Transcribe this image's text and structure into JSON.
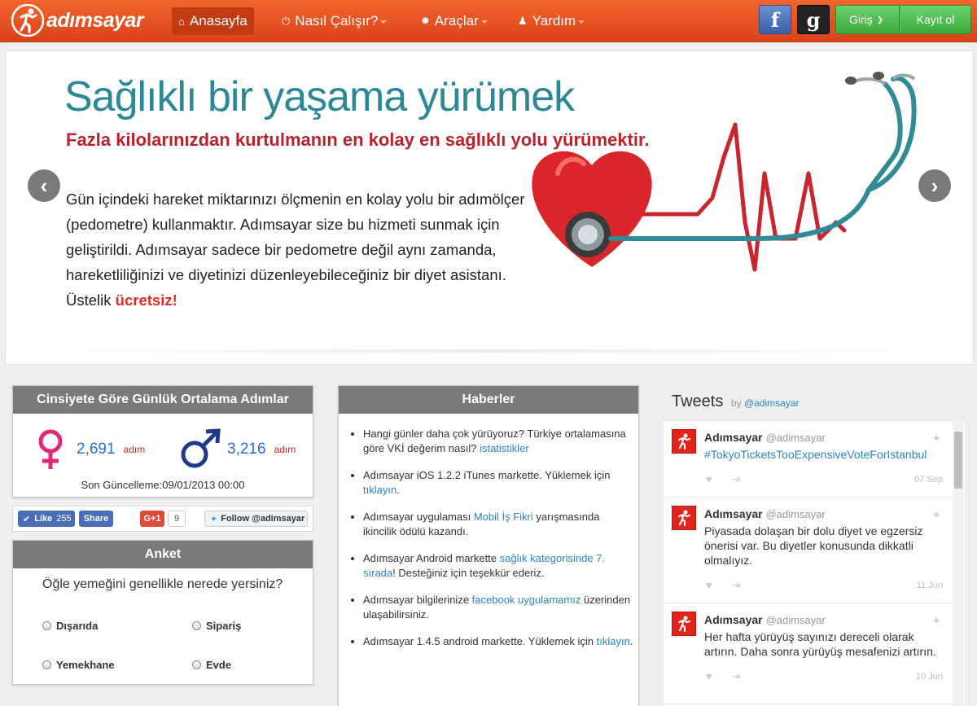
{
  "brand": {
    "name": "adımsayar"
  },
  "nav": {
    "items": [
      {
        "label": "Anasayfa",
        "icon": "home-icon"
      },
      {
        "label": "Nasıl Çalışır?",
        "icon": "power-icon"
      },
      {
        "label": "Araçlar",
        "icon": "gear-icon"
      },
      {
        "label": "Yardım",
        "icon": "user-icon"
      }
    ],
    "facebook": "f",
    "google": "g",
    "login": "Giriş",
    "register": "Kayıt ol"
  },
  "hero": {
    "title": "Sağlıklı bir yaşama yürümek",
    "subtitle": "Fazla kilolarınızdan kurtulmanın en kolay en sağlıklı yolu yürümektir.",
    "body": "Gün içindeki hareket miktarınızı ölçmenin en kolay yolu bir adımölçer (pedometre) kullanmaktır. Adımsayar size bu hizmeti sunmak için geliştirildi. Adımsayar sadece bir pedometre değil aynı zamanda, hareketliliğinizi ve diyetinizi düzenleyebileceğiniz bir diyet asistanı. Üstelik ",
    "highlight": "ücretsiz!",
    "prev": "‹",
    "next": "›"
  },
  "stats": {
    "title": "Cinsiyete Göre Günlük Ortalama Adımlar",
    "female": {
      "value": "2,691",
      "unit": "adım"
    },
    "male": {
      "value": "3,216",
      "unit": "adım"
    },
    "updated": "Son Güncelleme:09/01/2013 00:00"
  },
  "share": {
    "like": "Like",
    "like_count": "255",
    "share": "Share",
    "gplus": "G+1",
    "gplus_count": "9",
    "twitter_follow": "Follow @adimsayar"
  },
  "poll": {
    "title": "Anket",
    "question": "Öğle yemeğini genellikle nerede yersiniz?",
    "options": [
      "Dışarıda",
      "Sipariş",
      "Yemekhane",
      "Evde"
    ]
  },
  "news": {
    "title": "Haberler",
    "items": [
      {
        "before": "Hangi günler daha çok yürüyoruz? Türkiye ortalamasına göre VKİ değerim nasıl? ",
        "link": "istatistikler",
        "after": ""
      },
      {
        "before": "Adımsayar iOS 1.2.2 iTunes markette. Yüklemek için ",
        "link": "tıklayın",
        "after": "."
      },
      {
        "before": "Adımsayar uygulaması ",
        "link": "Mobil İş Fikri",
        "after": " yarışmasında ikincilik ödülü kazandı."
      },
      {
        "before": "Adımsayar Android markette ",
        "link": "sağlık kategorisinde 7. sırada",
        "after": "! Desteğiniz için teşekkür ederiz."
      },
      {
        "before": "Adımsayar bilgilerinize ",
        "link": "facebook uygulamamız",
        "after": " üzerinden ulaşabilirsiniz."
      },
      {
        "before": "Adımsayar 1.4.5 android markette. Yüklemek için ",
        "link": "tıklayın",
        "after": "."
      }
    ]
  },
  "tweets": {
    "title": "Tweets",
    "by": "by",
    "handle_link": "@adimsayar",
    "items": [
      {
        "name": "Adımsayar",
        "handle": "@adimsayar",
        "text": "#TokyoTicketsTooExpensiveVoteForIstanbul",
        "date": "07 Sep"
      },
      {
        "name": "Adımsayar",
        "handle": "@adimsayar",
        "text": "Piyasada dolaşan bir dolu diyet ve egzersiz önerisi var. Bu diyetler konusunda dikkatli olmalıyız.",
        "date": "11 Jun"
      },
      {
        "name": "Adımsayar",
        "handle": "@adimsayar",
        "text": "Her hafta yürüyüş sayınızı dereceli olarak artırın. Daha sonra yürüyüş mesafenizi artırın.",
        "date": "10 Jun"
      }
    ]
  },
  "colors": {
    "brand_orange": "#e8521f",
    "teal_title": "#2b8896",
    "red_subtitle": "#b8232c",
    "female_pink": "#e0287a",
    "male_navy": "#1f3a8a",
    "link_blue": "#2a85c8"
  }
}
